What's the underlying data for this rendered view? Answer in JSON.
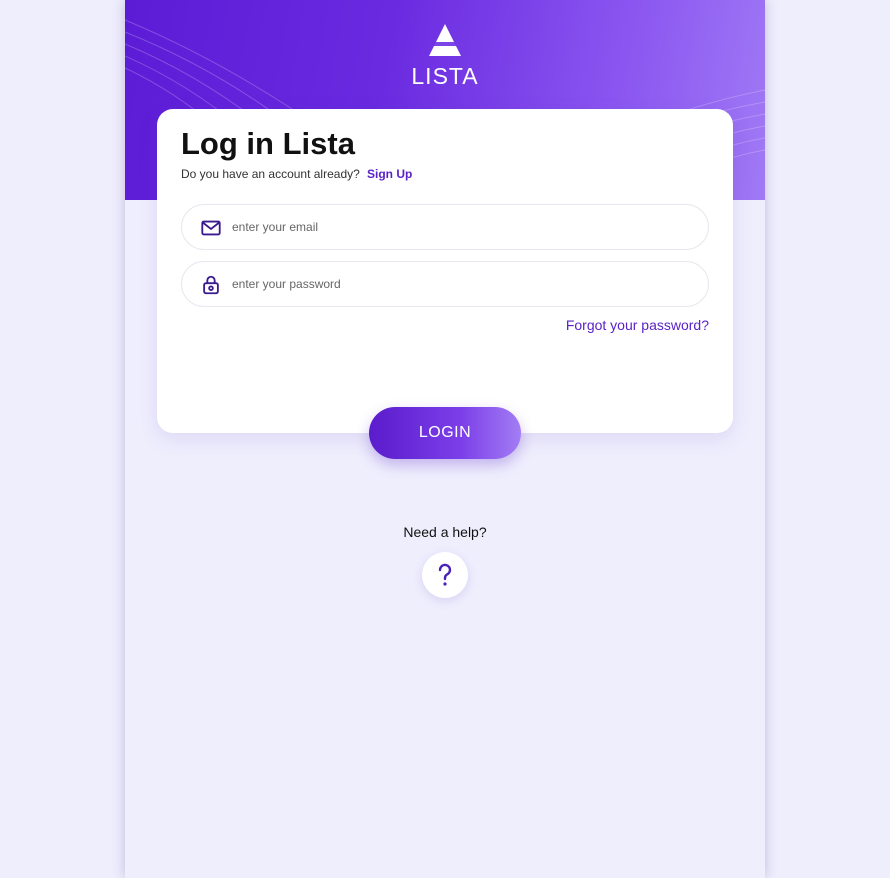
{
  "brand": {
    "name": "LISTA",
    "logo_icon": "lista-triangle-logo-icon",
    "gradient_start": "#5c1cd6",
    "gradient_end": "#a07af5"
  },
  "login": {
    "title": "Log in Lista",
    "account_question": "Do you have an account already?",
    "signup_label": "Sign Up",
    "email": {
      "icon": "mail-icon",
      "placeholder": "enter your email",
      "value": ""
    },
    "password": {
      "icon": "lock-icon",
      "placeholder": "enter your password",
      "value": ""
    },
    "forgot_label": "Forgot your password?",
    "submit_label": "LOGIN"
  },
  "help": {
    "label": "Need a help?",
    "icon": "question-mark-icon",
    "glyph": "?"
  },
  "colors": {
    "accent": "#5a22c8",
    "background": "#efeefd"
  }
}
